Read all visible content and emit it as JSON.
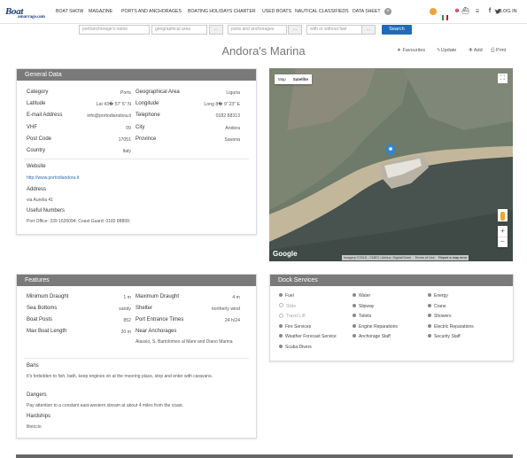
{
  "logo": {
    "text": "Boat",
    "sub": "amarrage.com"
  },
  "nav": [
    "BOAT SHOW",
    "MAGAZINE",
    "PORTS AND ANCHORAGES",
    "BOATING HOLIDAYS CHARTER",
    "USED BOATS",
    "NAUTICAL CLASSIFIEDS",
    "DATA SHEET"
  ],
  "login": "LOG IN",
  "search": {
    "name_placeholder": "port/anchorage's name",
    "area": "geographical area",
    "type": "ports and anchorages",
    "fuel": "with or without fuel",
    "button": "Search"
  },
  "title": "Andora's Marina",
  "actions": {
    "favourites": "Favourites",
    "update": "Update",
    "add": "Add",
    "print": "Print"
  },
  "general": {
    "heading": "General Data",
    "left": [
      {
        "label": "Category",
        "value": "Ports"
      },
      {
        "label": "Latitude",
        "value": "Lat 43� 57' 5'' N"
      },
      {
        "label": "E-mail Address",
        "value": "info@portodiandora.it"
      },
      {
        "label": "VHF",
        "value": "09"
      },
      {
        "label": "Post Code",
        "value": "17051"
      },
      {
        "label": "Country",
        "value": "Italy"
      }
    ],
    "right": [
      {
        "label": "Geographical Area",
        "value": "Liguria"
      },
      {
        "label": "Longitude",
        "value": "Long 8� 9' 23'' E"
      },
      {
        "label": "Telephone",
        "value": "0182 88313"
      },
      {
        "label": "City",
        "value": "Andora"
      },
      {
        "label": "Province",
        "value": "Savona"
      }
    ],
    "website_label": "Website",
    "website": "http://www.portodiandora.it",
    "address_label": "Address",
    "address": "via Aurelia 41",
    "numbers_label": "Useful Numbers",
    "numbers": "Port Office: 339 1626094; Coast Guard: 0182 88899;"
  },
  "map": {
    "tab_map": "Map",
    "tab_sat": "Satellite",
    "brand": "Google",
    "attribution": "Imagery ©2018 , CNES / Airbus, DigitalGlobe",
    "terms": "Terms of Use",
    "report": "Report a map error"
  },
  "features": {
    "heading": "Features",
    "left": [
      {
        "label": "Minimum Draught",
        "value": "1 m"
      },
      {
        "label": "Sea Bottoms",
        "value": "sandy"
      },
      {
        "label": "Boat Posts",
        "value": "852"
      },
      {
        "label": "Max Boat Length",
        "value": "20 m"
      }
    ],
    "right": [
      {
        "label": "Maximum Draught",
        "value": "4 m"
      },
      {
        "label": "Shelter",
        "value": "northerly wind"
      },
      {
        "label": "Port Entrance Times",
        "value": "24 h/24"
      },
      {
        "label": "Near Anchorages",
        "value": ""
      }
    ],
    "near": "Alassio, S. Bartolomeo al Mare and Diano Marina",
    "bans_label": "Bans",
    "bans": "It's forbidden to fish, bath, keep engines on at the mooring place, stop and enter with caravans.",
    "dangers_label": "Dangers",
    "dangers": "Pay attention to a constant east-western stream at about 4 miles from the coast.",
    "hardships_label": "Hardships",
    "hardships": "libeccio"
  },
  "dock": {
    "heading": "Dock Services",
    "col1": [
      {
        "label": "Fuel",
        "on": true
      },
      {
        "label": "Slide",
        "on": false
      },
      {
        "label": "Travel Lift",
        "on": false
      },
      {
        "label": "Fire Services",
        "on": true
      },
      {
        "label": "Weather Forecast Service",
        "on": true
      },
      {
        "label": "Scuba Divers",
        "on": true
      }
    ],
    "col2": [
      {
        "label": "Water",
        "on": true
      },
      {
        "label": "Slipway",
        "on": true
      },
      {
        "label": "Toilets",
        "on": true
      },
      {
        "label": "Engine Reparations",
        "on": true
      },
      {
        "label": "Anchorage Staff",
        "on": true
      }
    ],
    "col3": [
      {
        "label": "Energy",
        "on": true
      },
      {
        "label": "Crane",
        "on": true
      },
      {
        "label": "Showers",
        "on": true
      },
      {
        "label": "Electric Reparations",
        "on": true
      },
      {
        "label": "Security Staff",
        "on": true
      }
    ]
  }
}
